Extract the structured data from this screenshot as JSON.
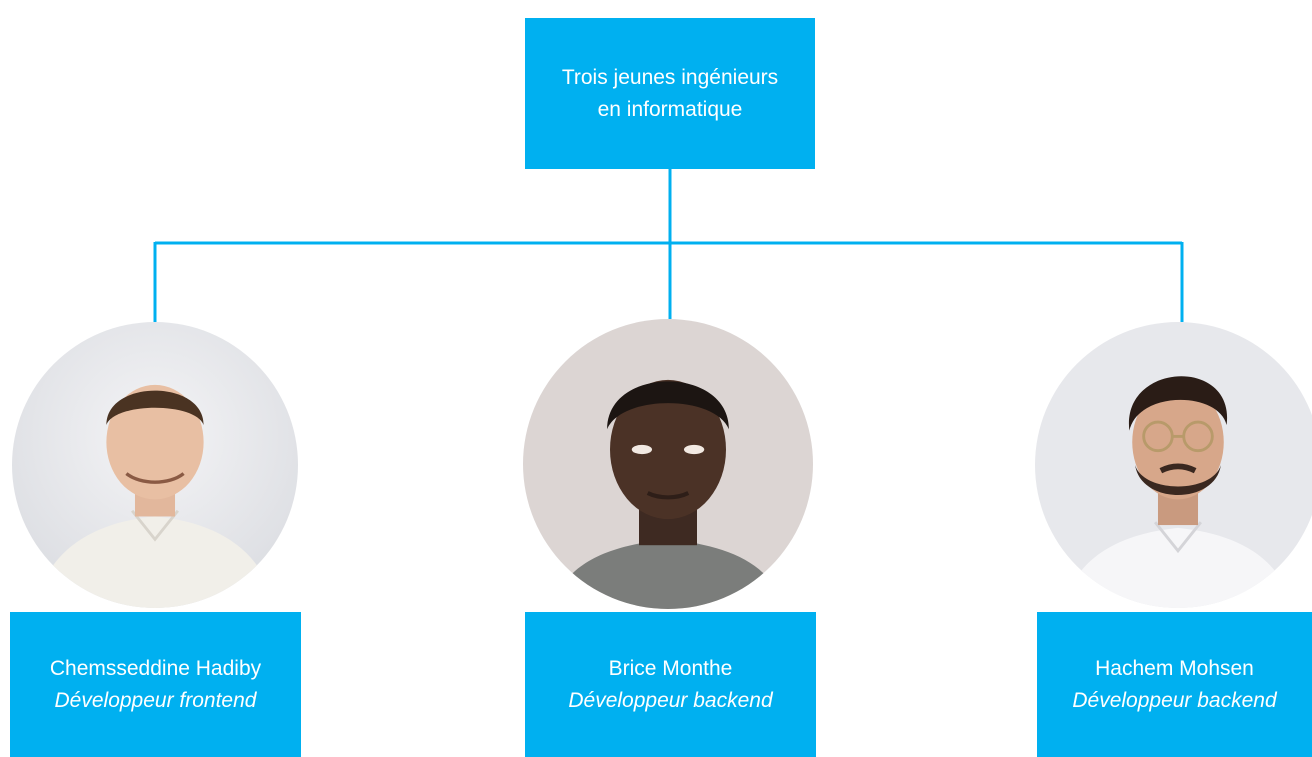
{
  "root": {
    "line1": "Trois jeunes ingénieurs",
    "line2": "en informatique"
  },
  "members": [
    {
      "name": "Chemsseddine Hadiby",
      "role": "Développeur frontend"
    },
    {
      "name": "Brice Monthe",
      "role": "Développeur backend"
    },
    {
      "name": "Hachem Mohsen",
      "role": "Développeur backend"
    }
  ],
  "colors": {
    "box": "#00b0f0",
    "connector": "#00b0f0",
    "text": "#ffffff"
  }
}
